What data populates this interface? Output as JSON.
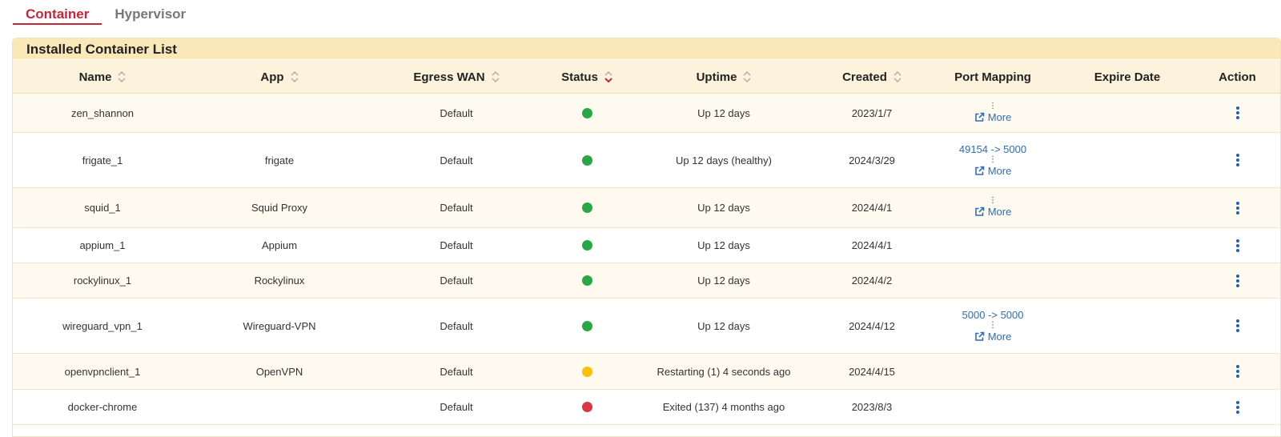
{
  "tabs": [
    {
      "label": "Container",
      "active": true
    },
    {
      "label": "Hypervisor",
      "active": false
    }
  ],
  "card": {
    "title": "Installed Container List"
  },
  "columns": {
    "name": "Name",
    "app": "App",
    "egress": "Egress WAN",
    "status": "Status",
    "uptime": "Uptime",
    "created": "Created",
    "port": "Port Mapping",
    "expire": "Expire Date",
    "action": "Action"
  },
  "more_label": "More",
  "status_colors": {
    "running": "#28a745",
    "restarting": "#ffc107",
    "exited": "#dc3545"
  },
  "accent_color": "#c8253a",
  "link_color": "#2f6db5",
  "rows": [
    {
      "name": "zen_shannon",
      "app": "",
      "egress": "Default",
      "status": "running",
      "uptime": "Up 12 days",
      "created": "2023/1/7",
      "port": "",
      "more": true,
      "expire": ""
    },
    {
      "name": "frigate_1",
      "app": "frigate",
      "egress": "Default",
      "status": "running",
      "uptime": "Up 12 days (healthy)",
      "created": "2024/3/29",
      "port": "49154 -> 5000",
      "more": true,
      "expire": ""
    },
    {
      "name": "squid_1",
      "app": "Squid Proxy",
      "egress": "Default",
      "status": "running",
      "uptime": "Up 12 days",
      "created": "2024/4/1",
      "port": "",
      "more": true,
      "expire": ""
    },
    {
      "name": "appium_1",
      "app": "Appium",
      "egress": "Default",
      "status": "running",
      "uptime": "Up 12 days",
      "created": "2024/4/1",
      "port": "",
      "more": false,
      "expire": ""
    },
    {
      "name": "rockylinux_1",
      "app": "Rockylinux",
      "egress": "Default",
      "status": "running",
      "uptime": "Up 12 days",
      "created": "2024/4/2",
      "port": "",
      "more": false,
      "expire": ""
    },
    {
      "name": "wireguard_vpn_1",
      "app": "Wireguard-VPN",
      "egress": "Default",
      "status": "running",
      "uptime": "Up 12 days",
      "created": "2024/4/12",
      "port": "5000 -> 5000",
      "more": true,
      "expire": ""
    },
    {
      "name": "openvpnclient_1",
      "app": "OpenVPN",
      "egress": "Default",
      "status": "restarting",
      "uptime": "Restarting (1) 4 seconds ago",
      "created": "2024/4/15",
      "port": "",
      "more": false,
      "expire": ""
    },
    {
      "name": "docker-chrome",
      "app": "",
      "egress": "Default",
      "status": "exited",
      "uptime": "Exited (137) 4 months ago",
      "created": "2023/8/3",
      "port": "",
      "more": false,
      "expire": ""
    }
  ]
}
